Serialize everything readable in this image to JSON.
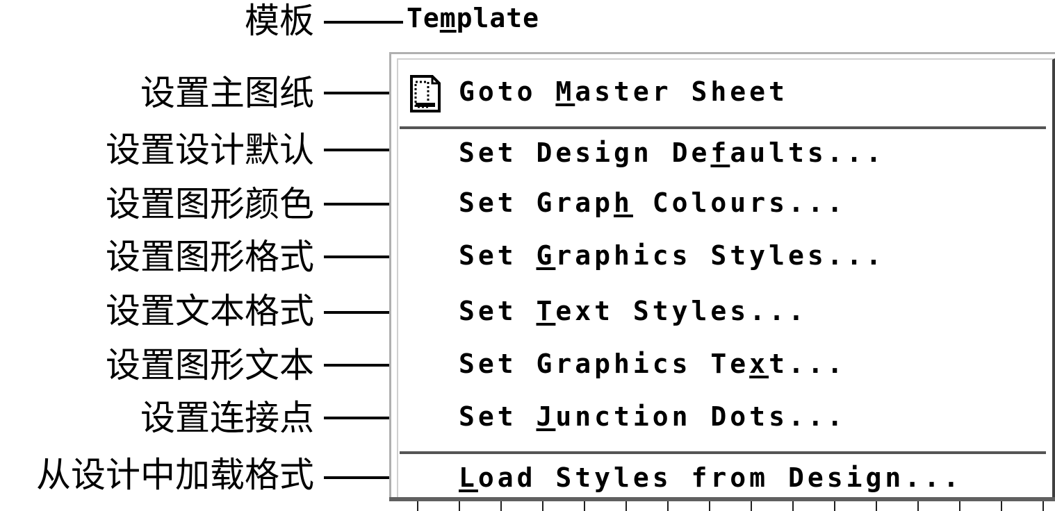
{
  "menu": {
    "title": {
      "before": "Te",
      "mnemonic": "m",
      "after": "plate"
    },
    "items": [
      {
        "id": "goto-master-sheet",
        "before": "Goto ",
        "mnemonic": "M",
        "after": "aster Sheet",
        "icon": "document-icon"
      },
      {
        "id": "set-design-defaults",
        "before": "Set Design De",
        "mnemonic": "f",
        "after": "aults..."
      },
      {
        "id": "set-graph-colours",
        "before": "Set Grap",
        "mnemonic": "h",
        "after": " Colours..."
      },
      {
        "id": "set-graphics-styles",
        "before": "Set ",
        "mnemonic": "G",
        "after": "raphics Styles..."
      },
      {
        "id": "set-text-styles",
        "before": "Set ",
        "mnemonic": "T",
        "after": "ext Styles..."
      },
      {
        "id": "set-graphics-text",
        "before": "Set Graphics Te",
        "mnemonic": "x",
        "after": "t..."
      },
      {
        "id": "set-junction-dots",
        "before": "Set ",
        "mnemonic": "J",
        "after": "unction Dots..."
      },
      {
        "id": "load-styles-from-design",
        "before": "",
        "mnemonic": "L",
        "after": "oad Styles from Design..."
      }
    ]
  },
  "annotations": {
    "template": "模板",
    "goto_master_sheet": "设置主图纸",
    "set_design_defaults": "设置设计默认",
    "set_graph_colours": "设置图形颜色",
    "set_graphics_styles": "设置图形格式",
    "set_text_styles": "设置文本格式",
    "set_graphics_text": "设置图形文本",
    "set_junction_dots": "设置连接点",
    "load_styles_from_design": "从设计中加载格式"
  },
  "colors": {
    "text": "#000000",
    "background": "#ffffff",
    "menu_border_light": "#b0b0b0",
    "menu_border_dark": "#404040",
    "separator": "#555555"
  }
}
